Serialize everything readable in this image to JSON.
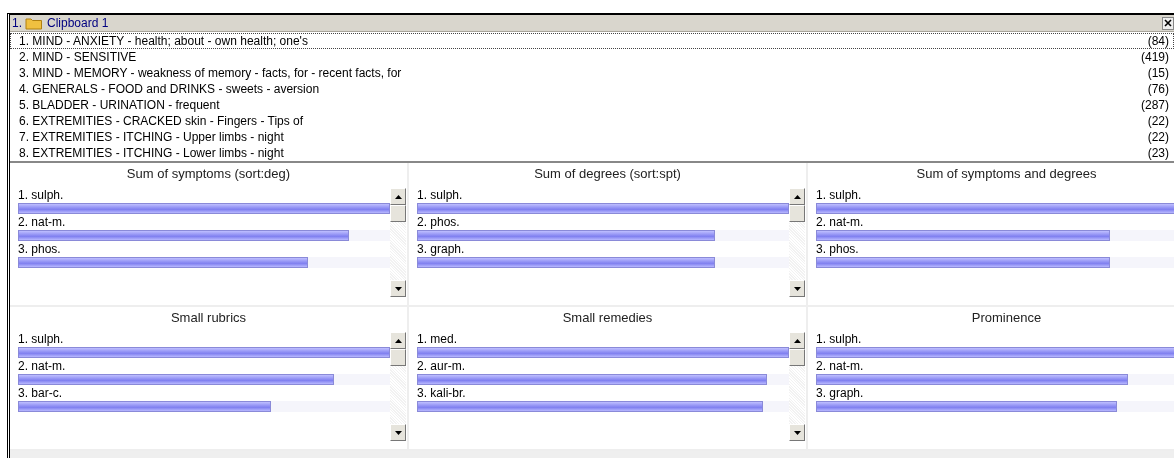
{
  "clipboard": {
    "number": "1.",
    "title": "Clipboard 1"
  },
  "rubrics": [
    {
      "label": "1. MIND - ANXIETY - health; about - own health; one's",
      "count": "(84)",
      "selected": true
    },
    {
      "label": "2. MIND - SENSITIVE",
      "count": "(419)",
      "selected": false
    },
    {
      "label": "3. MIND - MEMORY - weakness of memory - facts, for - recent facts, for",
      "count": "(15)",
      "selected": false
    },
    {
      "label": "4. GENERALS - FOOD and DRINKS - sweets - aversion",
      "count": "(76)",
      "selected": false
    },
    {
      "label": "5. BLADDER - URINATION - frequent",
      "count": "(287)",
      "selected": false
    },
    {
      "label": "6. EXTREMITIES - CRACKED skin - Fingers - Tips of",
      "count": "(22)",
      "selected": false
    },
    {
      "label": "7. EXTREMITIES - ITCHING - Upper limbs - night",
      "count": "(22)",
      "selected": false
    },
    {
      "label": "8. EXTREMITIES - ITCHING - Lower limbs - night",
      "count": "(23)",
      "selected": false
    }
  ],
  "panels": [
    {
      "title": "Sum of symptoms (sort:deg)",
      "remedies": [
        {
          "label": "1. sulph.",
          "level": 1.0
        },
        {
          "label": "2. nat-m.",
          "level": 0.89
        },
        {
          "label": "3. phos.",
          "level": 0.78
        }
      ]
    },
    {
      "title": "Sum of degrees (sort:spt)",
      "remedies": [
        {
          "label": "1. sulph.",
          "level": 1.0
        },
        {
          "label": "2. phos.",
          "level": 0.8
        },
        {
          "label": "3. graph.",
          "level": 0.8
        }
      ]
    },
    {
      "title": "Sum of symptoms and degrees",
      "remedies": [
        {
          "label": "1. sulph.",
          "level": 1.0
        },
        {
          "label": "2. nat-m.",
          "level": 0.79
        },
        {
          "label": "3. phos.",
          "level": 0.79
        }
      ]
    },
    {
      "title": "Small rubrics",
      "remedies": [
        {
          "label": "1. sulph.",
          "level": 1.0
        },
        {
          "label": "2. nat-m.",
          "level": 0.85
        },
        {
          "label": "3. bar-c.",
          "level": 0.68
        }
      ]
    },
    {
      "title": "Small remedies",
      "remedies": [
        {
          "label": "1. med.",
          "level": 1.0
        },
        {
          "label": "2. aur-m.",
          "level": 0.94
        },
        {
          "label": "3. kali-br.",
          "level": 0.93
        }
      ]
    },
    {
      "title": "Prominence",
      "remedies": [
        {
          "label": "1. sulph.",
          "level": 1.0
        },
        {
          "label": "2. nat-m.",
          "level": 0.84
        },
        {
          "label": "3. graph.",
          "level": 0.81
        }
      ]
    }
  ]
}
